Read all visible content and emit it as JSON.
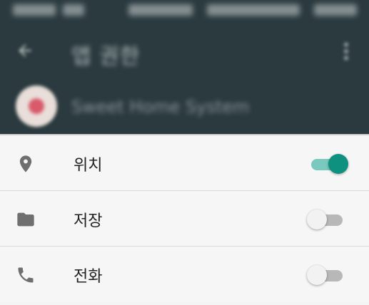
{
  "header": {
    "title": "앱 권한",
    "app_name": "Sweet Home System"
  },
  "colors": {
    "appbar": "#2a3a3e",
    "accent": "#0f9180",
    "accent_track": "#79c9bf"
  },
  "permissions": [
    {
      "label": "위치",
      "icon": "location-pin-icon",
      "enabled": true
    },
    {
      "label": "저장",
      "icon": "folder-icon",
      "enabled": false
    },
    {
      "label": "전화",
      "icon": "phone-icon",
      "enabled": false
    }
  ]
}
